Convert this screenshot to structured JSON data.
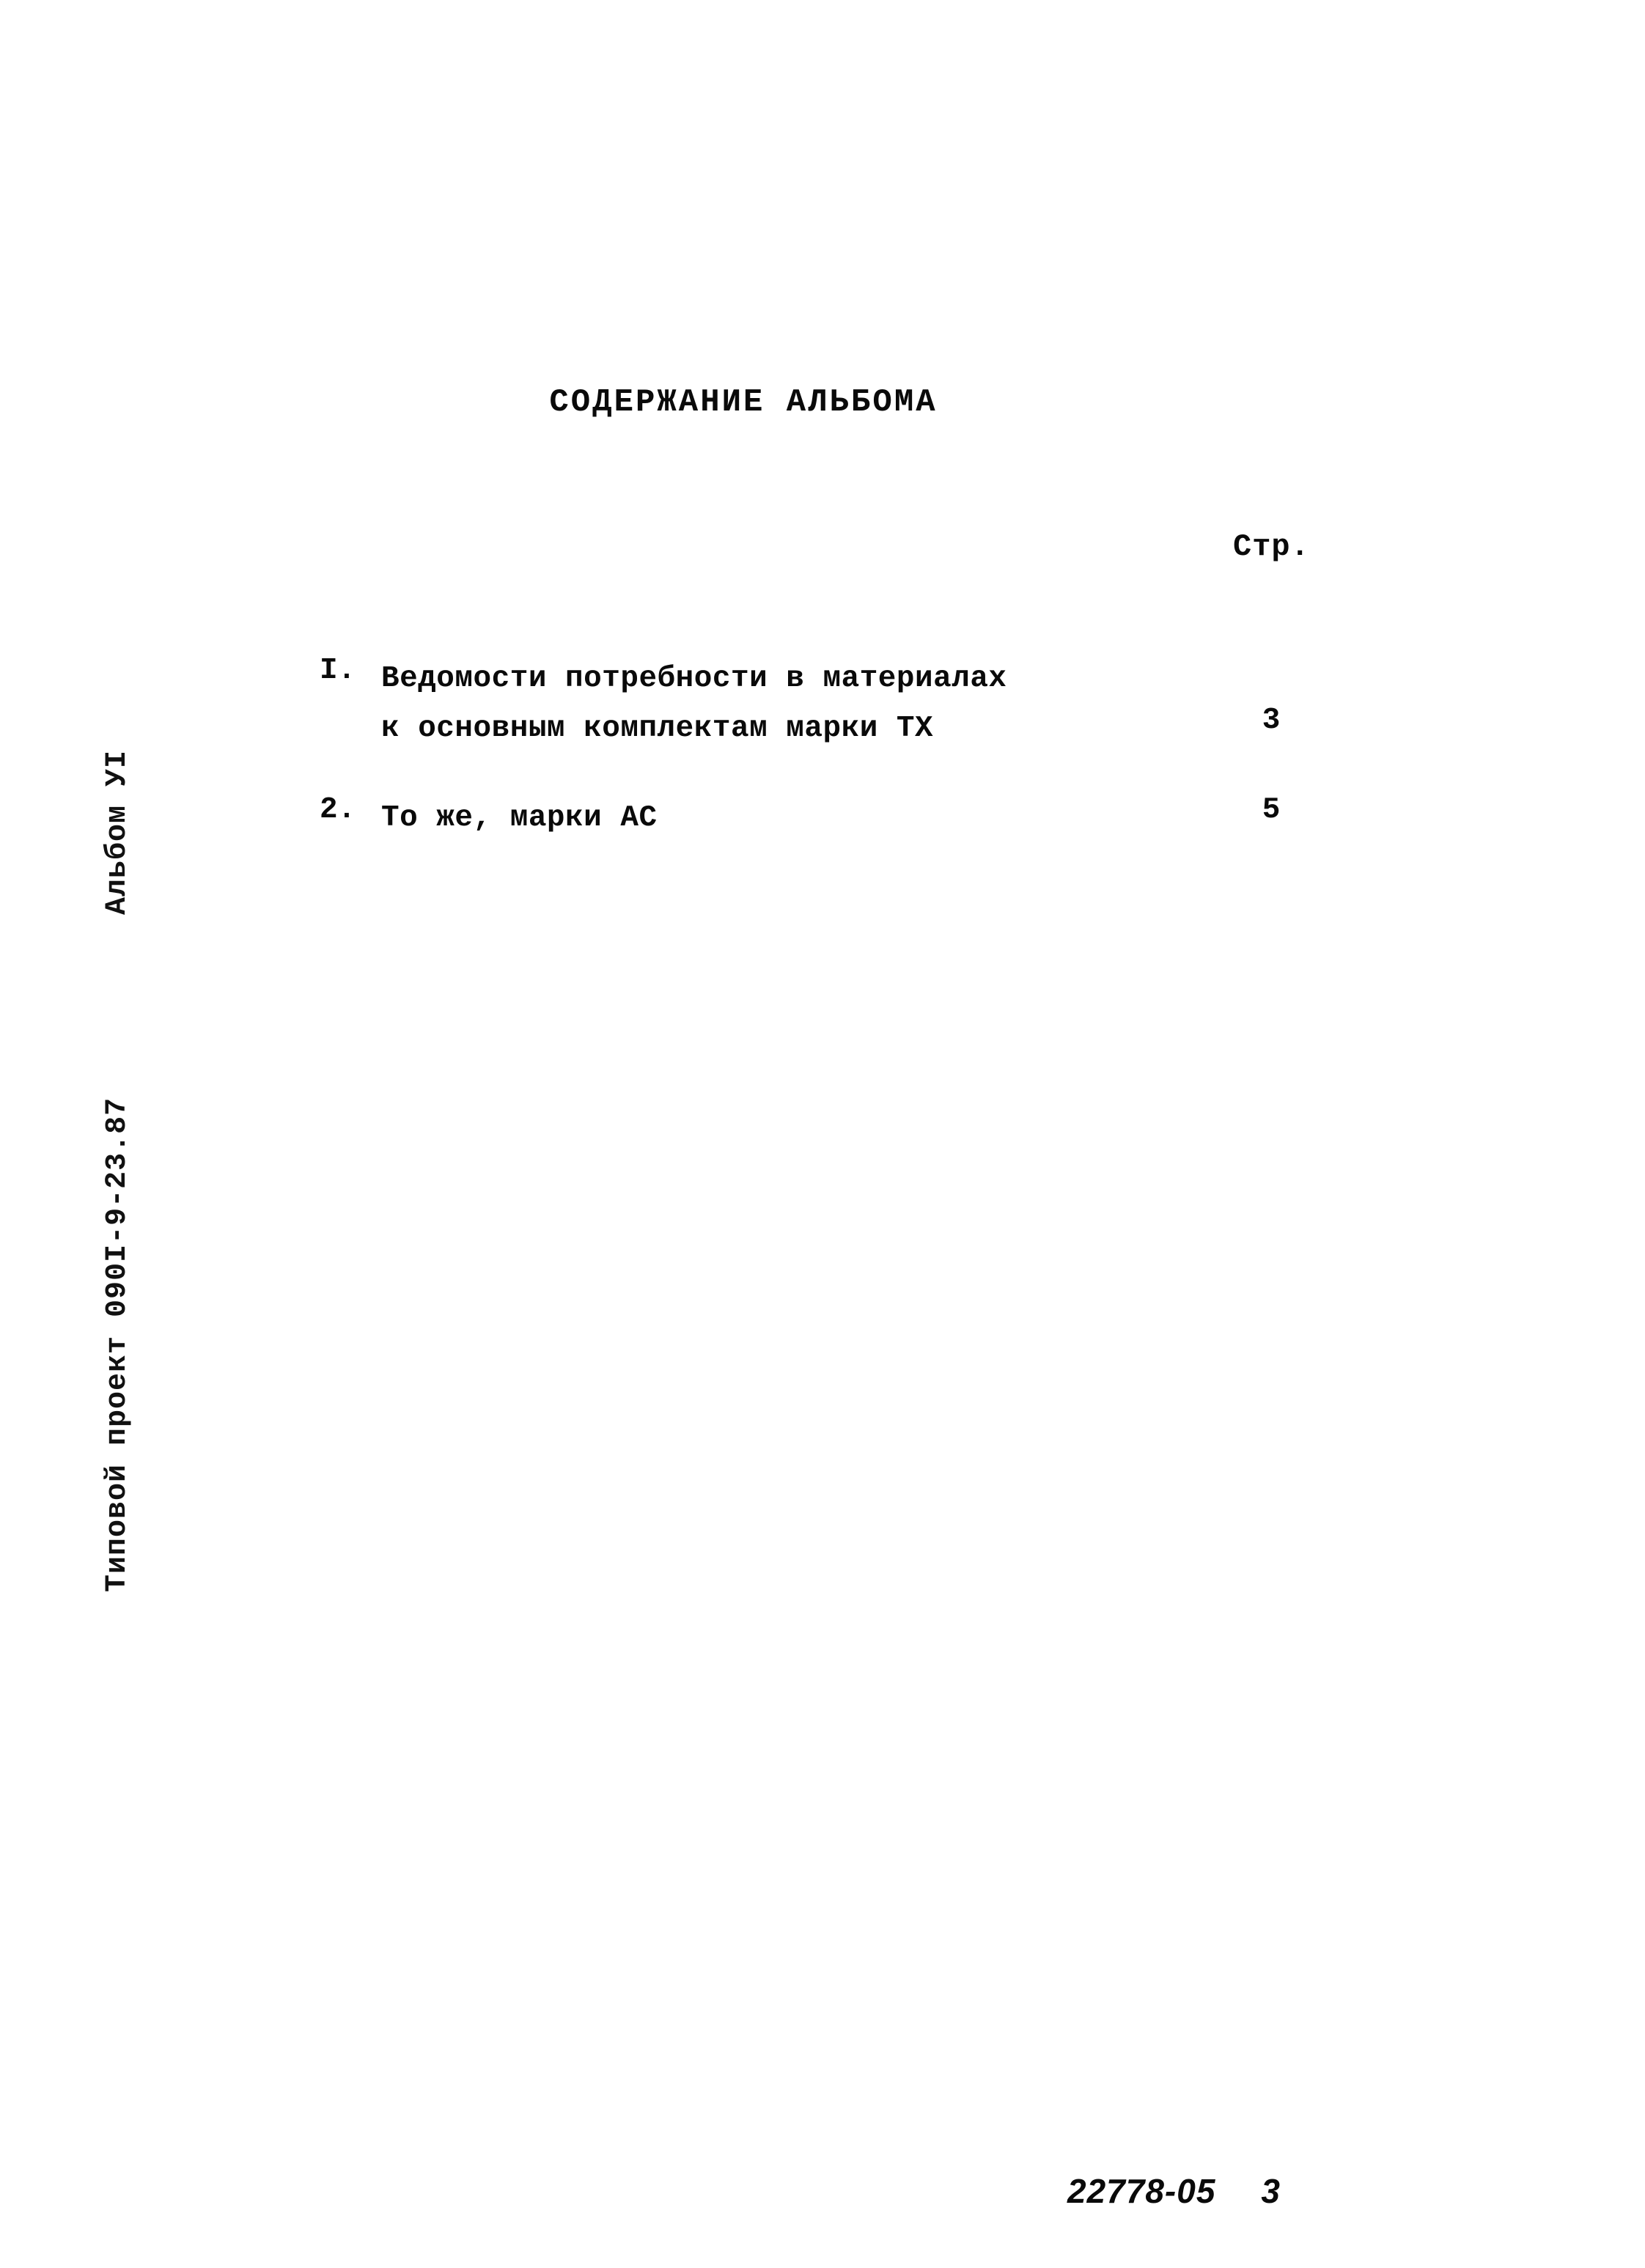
{
  "document": {
    "title": "СОДЕРЖАНИЕ АЛЬБОМА",
    "pages_column_header": "Стр.",
    "margin": {
      "album_label": "Альбом УI",
      "project_label": "Типовой проект 090I-9-23.87"
    },
    "contents": [
      {
        "number": "I.",
        "lines": [
          "Ведомости потребности в материалах",
          "к основным комплектам марки ТХ"
        ],
        "page": "3"
      },
      {
        "number": "2.",
        "lines": [
          "То же, марки АС"
        ],
        "page": "5"
      }
    ],
    "footer": {
      "code": "22778-05",
      "page": "3"
    }
  }
}
